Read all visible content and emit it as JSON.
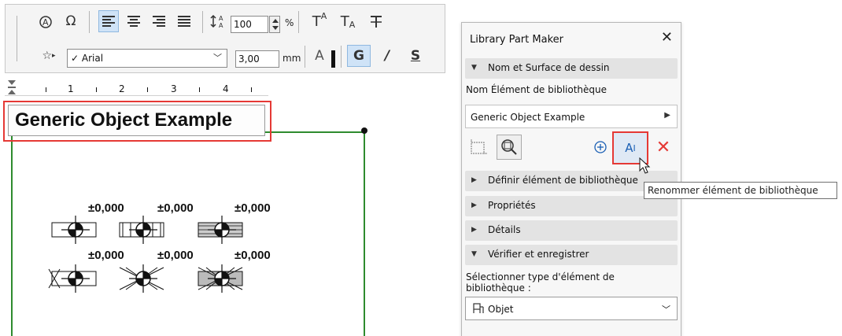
{
  "toolbar": {
    "font_name": "Arial",
    "font_check": "✓",
    "font_size": "100",
    "font_size_unit": "%",
    "text_height": "3,00",
    "text_height_unit": "mm",
    "bold_label": "G",
    "italic_label": "/",
    "underline_label": "S",
    "color_label": "A",
    "superscript_label": "T",
    "superscript_sup": "A",
    "subscript_label": "T",
    "subscript_sub": "A"
  },
  "ruler": {
    "numbers": [
      "1",
      "2",
      "3",
      "4"
    ]
  },
  "canvas": {
    "object_name": "Generic Object Example",
    "elevations": [
      "±0,000",
      "±0,000",
      "±0,000",
      "±0,000",
      "±0,000",
      "±0,000"
    ]
  },
  "panel": {
    "title": "Library Part Maker",
    "close": "✕",
    "section_name": "Nom et Surface de dessin",
    "name_label": "Nom Élément de bibliothèque",
    "name_value": "Generic Object Example",
    "rename_icon_label": "A",
    "rename_icon_sup": "I",
    "tooltip": "Renommer élément de bibliothèque",
    "sections": [
      {
        "label": "Définir élément de bibliothèque"
      },
      {
        "label": "Propriétés"
      },
      {
        "label": "Détails"
      },
      {
        "label": "Vérifier et enregistrer"
      }
    ],
    "select_type_label": "Sélectionner type d'élément de bibliothèque :",
    "select_type_value": "Objet"
  },
  "colors": {
    "highlight": "#e53935",
    "drawing_border": "#2e8b2e",
    "accent": "#1a5fb4"
  }
}
